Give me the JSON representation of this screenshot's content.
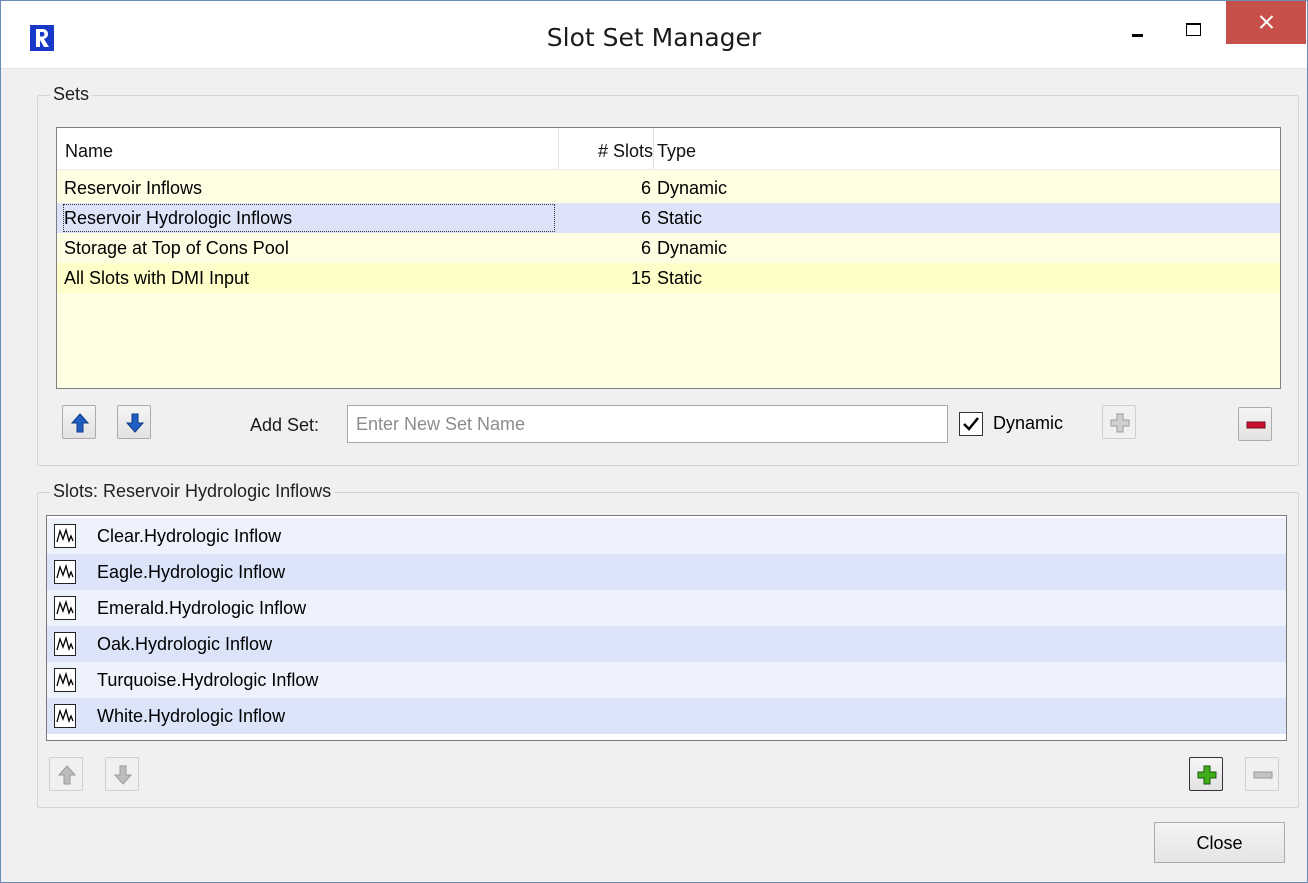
{
  "window": {
    "title": "Slot Set Manager"
  },
  "sets_group": {
    "title": "Sets",
    "columns": {
      "name": "Name",
      "slots": "# Slots",
      "type": "Type"
    },
    "rows": [
      {
        "name": "Reservoir Inflows",
        "slots": "6",
        "type": "Dynamic",
        "bg": "#fefee2",
        "selected": false
      },
      {
        "name": "Reservoir Hydrologic Inflows",
        "slots": "6",
        "type": "Static",
        "bg": "#dde4fa",
        "selected": true
      },
      {
        "name": "Storage at Top of Cons Pool",
        "slots": "6",
        "type": "Dynamic",
        "bg": "#fefee2",
        "selected": false
      },
      {
        "name": "All Slots with  DMI Input",
        "slots": "15",
        "type": "Static",
        "bg": "#fefec8",
        "selected": false
      }
    ],
    "add_set_label": "Add Set:",
    "add_set_placeholder": "Enter New Set Name",
    "add_set_value": "",
    "dynamic_label": "Dynamic",
    "dynamic_checked": true
  },
  "slots_group": {
    "title": "Slots: Reservoir Hydrologic Inflows",
    "items": [
      "Clear.Hydrologic Inflow",
      "Eagle.Hydrologic Inflow",
      "Emerald.Hydrologic Inflow",
      "Oak.Hydrologic Inflow",
      "Turquoise.Hydrologic Inflow",
      "White.Hydrologic Inflow"
    ]
  },
  "footer": {
    "close_label": "Close"
  },
  "colors": {
    "close_button_red": "#c7504b",
    "arrow_blue": "#1f5fc4",
    "remove_red": "#c8102e",
    "add_green": "#3fae1a",
    "table_yellow": "#fefee2",
    "list_row_light": "#eef2fc",
    "list_row_dark": "#dce4fa"
  }
}
